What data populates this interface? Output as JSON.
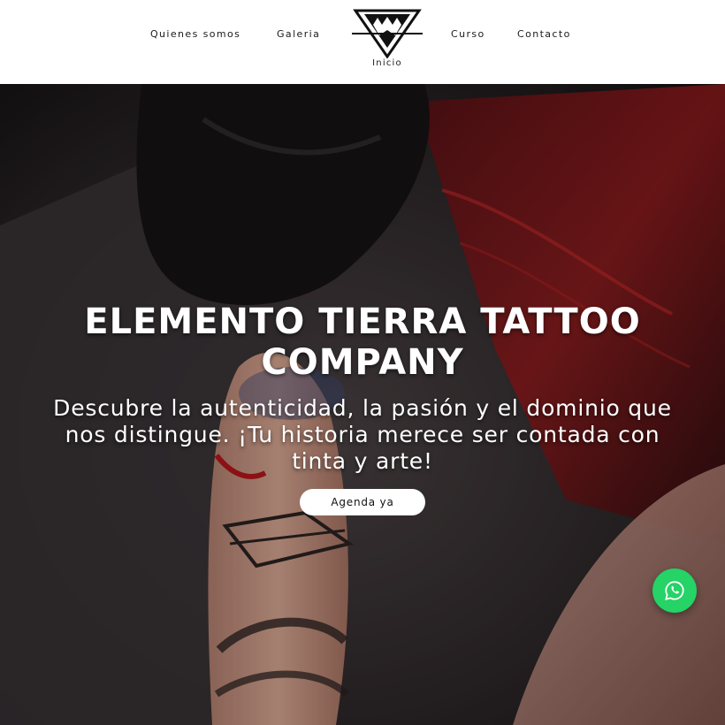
{
  "nav": {
    "items": [
      {
        "label": "Quienes somos"
      },
      {
        "label": "Galeria"
      },
      {
        "label": "Curso"
      },
      {
        "label": "Contacto"
      }
    ],
    "logo_label": "Inicio",
    "logo_icon": "triangle-logo-icon"
  },
  "hero": {
    "title": "ELEMENTO TIERRA TATTOO COMPANY",
    "subtitle": "Descubre la autenticidad, la pasión y el dominio que nos distingue. ¡Tu historia merece ser contada con tinta y arte!",
    "cta_label": "Agenda ya",
    "image_icon": "tattoo-artist-photo"
  },
  "whatsapp": {
    "icon": "whatsapp-icon",
    "color": "#25d366"
  }
}
